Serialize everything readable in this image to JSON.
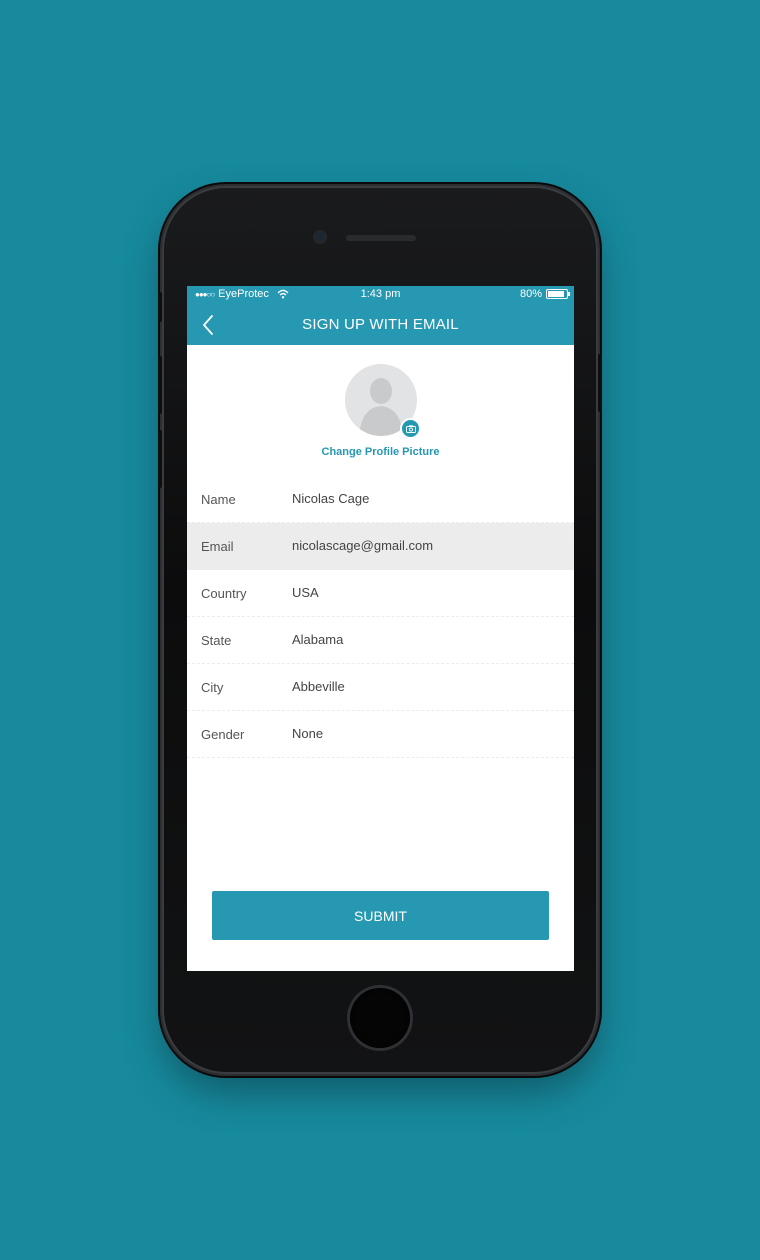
{
  "status_bar": {
    "signal": "●●●○○",
    "carrier": "EyeProtec",
    "time": "1:43 pm",
    "battery": "80%",
    "battery_level": 0.8
  },
  "nav": {
    "title": "SIGN UP WITH EMAIL",
    "back_icon": "chevron-left-icon"
  },
  "profile": {
    "avatar_icon": "person-silhouette-icon",
    "badge_icon": "camera-icon",
    "change_label": "Change Profile Picture"
  },
  "form": {
    "rows": [
      {
        "label": "Name",
        "value": "Nicolas Cage"
      },
      {
        "label": "Email",
        "value": "nicolascage@gmail.com"
      },
      {
        "label": "Country",
        "value": "USA"
      },
      {
        "label": "State",
        "value": "Alabama"
      },
      {
        "label": "City",
        "value": "Abbeville"
      },
      {
        "label": "Gender",
        "value": "None"
      }
    ],
    "active_row": "Email"
  },
  "submit_label": "SUBMIT",
  "colors": {
    "background": "#178a9e",
    "accent": "#2698b2",
    "active_row": "#ececec"
  }
}
